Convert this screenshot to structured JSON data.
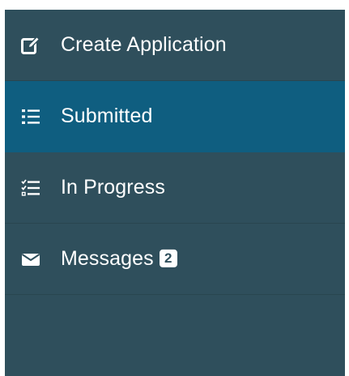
{
  "sidebar": {
    "items": [
      {
        "label": "Create Application",
        "icon": "edit-icon",
        "active": false
      },
      {
        "label": "Submitted",
        "icon": "list-icon",
        "active": true
      },
      {
        "label": "In Progress",
        "icon": "task-list-icon",
        "active": false
      },
      {
        "label": "Messages",
        "icon": "envelope-icon",
        "active": false,
        "badge": "2"
      }
    ]
  },
  "colors": {
    "sidebar_bg": "#2f4f5c",
    "active_bg": "#0f5e80",
    "text": "#ffffff"
  }
}
